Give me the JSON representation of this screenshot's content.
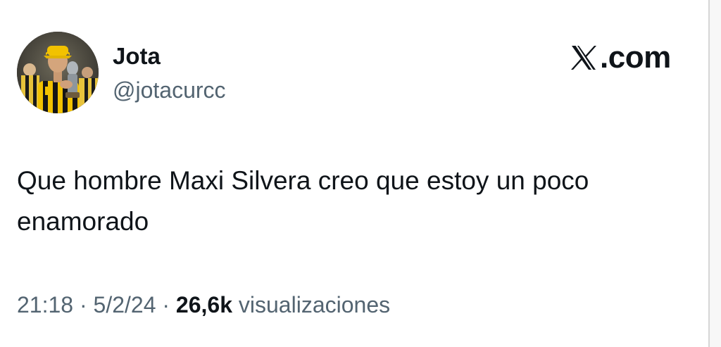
{
  "author": {
    "name": "Jota",
    "handle": "@jotacurcc"
  },
  "brand": {
    "domain": ".com",
    "icon": "x-logo-icon"
  },
  "tweet": {
    "text": "Que hombre Maxi Silvera creo que estoy un poco enamorado"
  },
  "meta": {
    "time": "21:18",
    "separator_1": " · ",
    "date": "5/2/24",
    "separator_2": " · ",
    "views_count": "26,6k",
    "views_label": " visualizaciones"
  },
  "colors": {
    "text_primary": "#0f1419",
    "text_secondary": "#536471",
    "background": "#ffffff",
    "avatar_jersey_yellow": "#f2c200"
  }
}
